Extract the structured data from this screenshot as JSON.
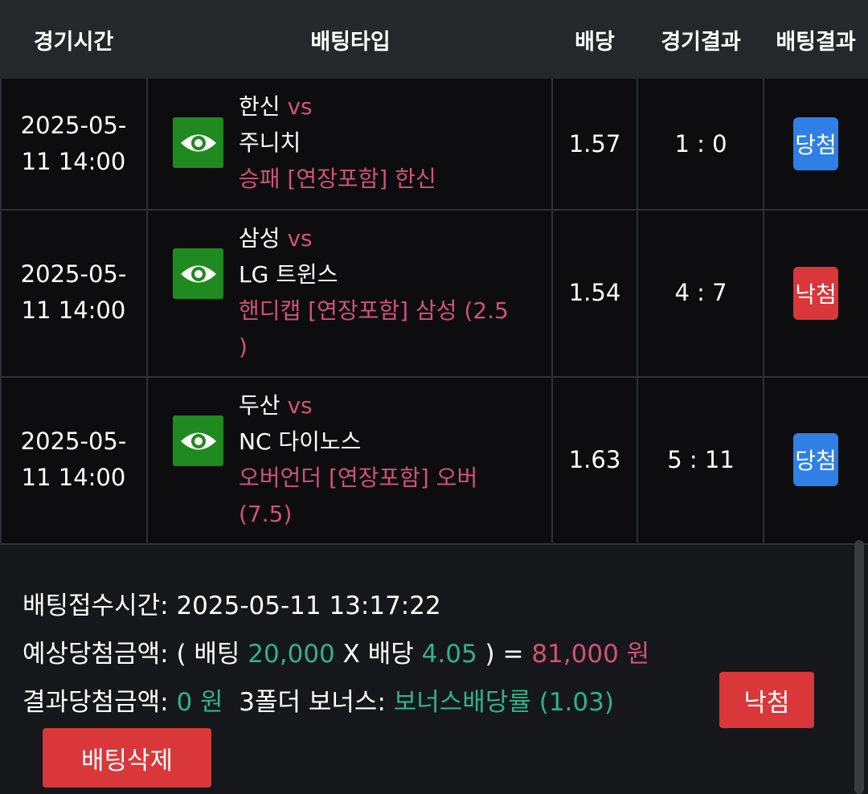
{
  "header": {
    "time": "경기시간",
    "bet_type": "배팅타입",
    "odds": "배당",
    "game_result": "경기결과",
    "bet_result": "배팅결과"
  },
  "rows": [
    {
      "time_line1": "2025-05-",
      "time_line2": "11 14:00",
      "home": "한신",
      "vs": "vs",
      "away": "주니치",
      "type_line1": "승패 [연장포함] 한신",
      "type_line2": "",
      "odds": "1.57",
      "score": "1 : 0",
      "result": "당첨",
      "result_color": "#2f7fe6"
    },
    {
      "time_line1": "2025-05-",
      "time_line2": "11 14:00",
      "home": "삼성",
      "vs": "vs",
      "away": "LG 트윈스",
      "type_line1": "핸디캡 [연장포함] 삼성 (2.5",
      "type_line2": ")",
      "odds": "1.54",
      "score": "4 : 7",
      "result": "낙첨",
      "result_color": "#d9373a"
    },
    {
      "time_line1": "2025-05-",
      "time_line2": "11 14:00",
      "home": "두산",
      "vs": "vs",
      "away": "NC 다이노스",
      "type_line1": "오버언더 [연장포함] 오버",
      "type_line2": "(7.5)",
      "odds": "1.63",
      "score": "5 : 11",
      "result": "당첨",
      "result_color": "#2f7fe6"
    }
  ],
  "icons": {
    "view": "eye-icon"
  },
  "summary": {
    "received_label": "배팅접수시간:",
    "received_value": "2025-05-11 13:17:22",
    "expected_label": "예상당첨금액:",
    "expected_open": "( 배팅",
    "expected_stake": "20,000",
    "expected_x": "X 배당",
    "expected_odds": "4.05",
    "expected_close": ") =",
    "expected_amount": "81,000 원",
    "result_label": "결과당첨금액:",
    "result_amount": "0 원",
    "bonus_label": "3폴더 보너스:",
    "bonus_value": "보너스배당률 (1.03)",
    "status_button": "낙첨",
    "delete_button": "배팅삭제"
  },
  "colors": {
    "header_bg": "#25272b",
    "table_bg": "#0d0d0f",
    "accent_green": "#2fb38a",
    "accent_pink": "#d0527a",
    "win_blue": "#2f7fe6",
    "lose_red": "#d9373a",
    "eye_green": "#1f8a1f"
  }
}
